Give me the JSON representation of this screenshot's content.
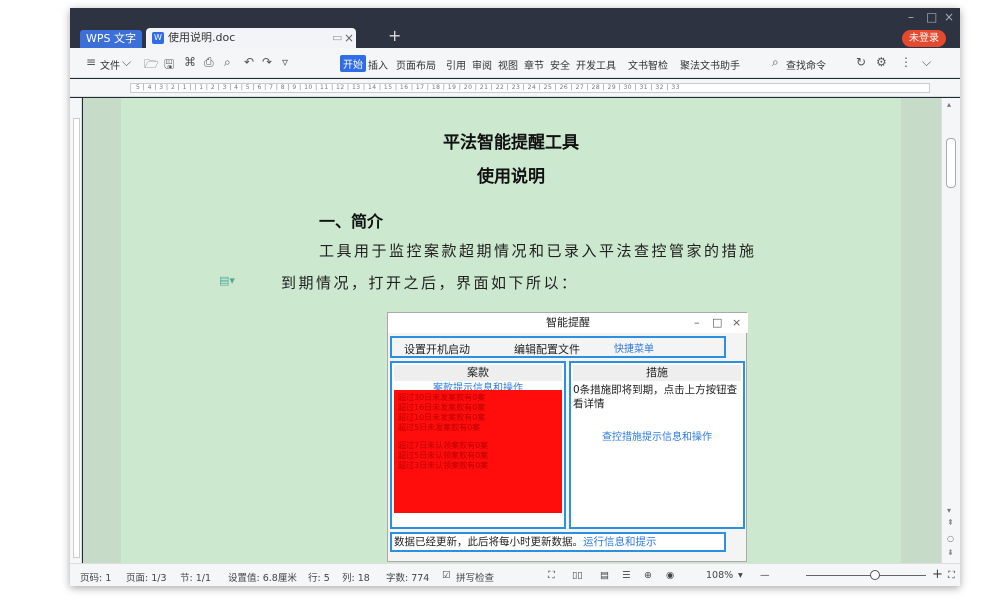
{
  "titlebar": {
    "app_tab": "WPS 文字",
    "doc_tab": "使用说明.doc",
    "new_tab": "+",
    "login": "未登录"
  },
  "menu": {
    "file": "文件",
    "items": [
      "开始",
      "插入",
      "页面布局",
      "引用",
      "审阅",
      "视图",
      "章节",
      "安全",
      "开发工具",
      "文书智检",
      "聚法文书助手"
    ],
    "search": "查找命令"
  },
  "ruler": {
    "numbers": "5 | 4 | 3 | 2 | 1 |     | 1 | 2 | 3 | 4 | 5 | 6 | 7 | 8 | 9 | 10 | 11 | 12 | 13 | 14 | 15 | 16 | 17 | 18 | 19 | 20 | 21 | 22 | 23 | 24 | 25 | 26 | 27 | 28 | 29 | 30 | 31 | 32 | 33"
  },
  "document": {
    "title": "平法智能提醒工具",
    "subtitle": "使用说明",
    "section": "一、简介",
    "para_line1": "工具用于监控案款超期情况和已录入平法查控管家的措施",
    "para_line2": "到期情况，打开之后，界面如下所以："
  },
  "dialog": {
    "title": "智能提醒",
    "btn_startup": "设置开机启动",
    "btn_config": "编辑配置文件",
    "quick_menu": "快捷菜单",
    "left_head": "案款",
    "left_hint": "案款提示信息和操作",
    "red_lines_1": [
      "超过30日未发案款有0案",
      "超过16日未发案款有0案",
      "超过10日未发案款有0案",
      "超过5日未发案款有0案"
    ],
    "red_lines_2": [
      "超过7日未认领案款有0案",
      "超过5日未认领案款有0案",
      "超过3日未认领案款有0案"
    ],
    "right_head": "措施",
    "right_text": "0条措施即将到期，点击上方按钮查看详情",
    "right_link": "查控措施提示信息和操作",
    "status_text": "数据已经更新，此后将每小时更新数据。",
    "status_link": "运行信息和提示"
  },
  "statusbar": {
    "page_code": "页码: 1",
    "page": "页面: 1/3",
    "section": "节: 1/1",
    "setting": "设置值: 6.8厘米",
    "row": "行: 5",
    "col": "列: 18",
    "words": "字数: 774",
    "spell": "拼写检查",
    "zoom": "108%",
    "plus": "+"
  },
  "colors": {
    "accent": "#2f6ce6",
    "page_bg": "#cce8cf",
    "alert_red": "#ff0d0d",
    "login_red": "#e64a2e",
    "link_blue": "#2d7be0"
  }
}
